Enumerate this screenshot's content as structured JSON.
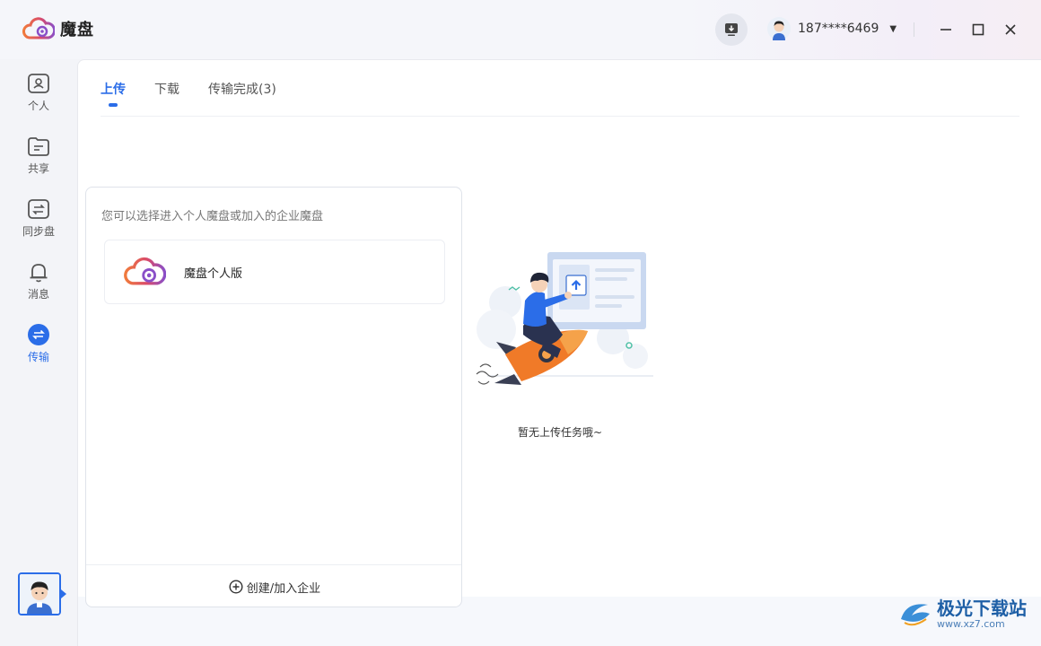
{
  "app": {
    "name": "魔盘"
  },
  "header": {
    "user_phone": "187****6469"
  },
  "sidebar": {
    "items": [
      {
        "label": "个人"
      },
      {
        "label": "共享"
      },
      {
        "label": "同步盘"
      },
      {
        "label": "消息"
      },
      {
        "label": "传输"
      }
    ],
    "active": "传输"
  },
  "tabs": [
    {
      "label": "上传",
      "active": true
    },
    {
      "label": "下载",
      "active": false
    },
    {
      "label": "传输完成(3)",
      "active": false
    }
  ],
  "panel": {
    "hint": "您可以选择进入个人魔盘或加入的企业魔盘",
    "personal_label": "魔盘个人版",
    "footer_label": "创建/加入企业"
  },
  "empty_state": {
    "message": "暂无上传任务哦~"
  },
  "watermark": {
    "title": "极光下载站",
    "url": "www.xz7.com"
  },
  "colors": {
    "accent": "#2b6de8",
    "brand_orange": "#ef6a3a",
    "brand_purple": "#8a4fc8"
  }
}
